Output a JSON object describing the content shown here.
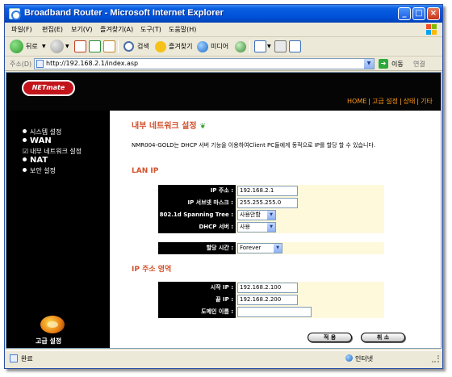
{
  "window": {
    "title": "Broadband Router - Microsoft Internet Explorer"
  },
  "menu": [
    "파일(F)",
    "편집(E)",
    "보기(V)",
    "즐겨찾기(A)",
    "도구(T)",
    "도움말(H)"
  ],
  "toolbar": {
    "back_label": "뒤로",
    "search_label": "검색",
    "favorites_label": "즐겨찾기",
    "media_label": "미디어"
  },
  "address": {
    "label": "주소(D)",
    "url": "http://192.168.2.1/index.asp",
    "go_label": "이동",
    "links_label": "연결"
  },
  "header": {
    "logo_text": "NETmate",
    "links": [
      "HOME",
      "고급 설정",
      "상태",
      "기타"
    ],
    "link_colors": {
      "active": "#ff9a1a"
    }
  },
  "sidebar": {
    "items": [
      {
        "label": "시스템 설정",
        "style": "small"
      },
      {
        "label": "WAN",
        "style": "big"
      },
      {
        "label": "내부 네트워크 설정",
        "style": "checked"
      },
      {
        "label": "NAT",
        "style": "big"
      },
      {
        "label": "보안 설정",
        "style": "small"
      }
    ],
    "advanced_label": "고급 설정"
  },
  "main": {
    "title": "내부 네트워크 설정",
    "description": "NMR004-GOLD는 DHCP 서버 기능을 이용하여Client PC들에게 동적으로 IP를 할당 할 수 있습니다.",
    "lan_section": "LAN IP",
    "ip_label": "IP 주소 :",
    "ip_value": "192.168.2.1",
    "mask_label": "IP 서브넷 마스크 :",
    "mask_value": "255.255.255.0",
    "stp_label": "802.1d Spanning Tree :",
    "stp_value": "사용안함",
    "dhcp_label": "DHCP 서버 :",
    "dhcp_value": "사용",
    "lease_label": "할당 시간 :",
    "lease_value": "Forever",
    "range_section": "IP 주소 영역",
    "start_label": "시작 IP :",
    "start_value": "192.168.2.100",
    "end_label": "끝 IP :",
    "end_value": "192.168.2.200",
    "domain_label": "도메인 이름 :",
    "domain_value": "",
    "apply_label": "적 용",
    "cancel_label": "취 소"
  },
  "status": {
    "text": "완료",
    "zone": "인터넷"
  },
  "colors": {
    "title_bar": "#0050d8",
    "section_title": "#d2512b",
    "label_bg": "#000000",
    "value_bg": "#fff9dc",
    "header_bg": "#050505"
  }
}
